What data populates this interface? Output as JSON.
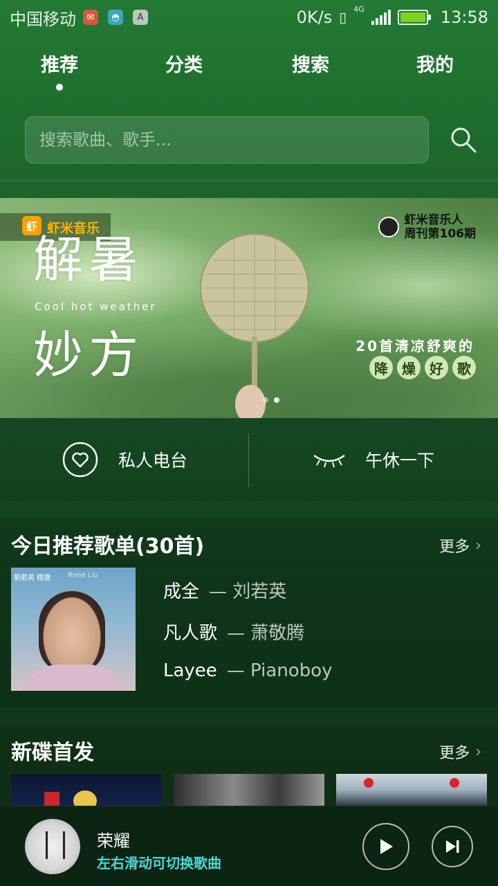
{
  "status_bar": {
    "carrier": "中国移动",
    "speed": "0K/s",
    "network": "4G",
    "time": "13:58",
    "app_icons": [
      "mail-icon",
      "android-icon",
      "a-icon"
    ]
  },
  "tabs": [
    {
      "label": "推荐",
      "active": true
    },
    {
      "label": "分类",
      "active": false
    },
    {
      "label": "搜索",
      "active": false
    },
    {
      "label": "我的",
      "active": false
    }
  ],
  "search": {
    "placeholder": "搜索歌曲、歌手..."
  },
  "banner": {
    "brand": "虾米音乐",
    "brand_logo": "虾",
    "title_line1": "解暑",
    "title_line2": "妙方",
    "subtitle": "Cool hot weather",
    "weekly_name": "虾米音乐人",
    "weekly_issue": "周刊第106期",
    "promo_line": "20首清凉舒爽的",
    "promo_chips": [
      "降",
      "燥",
      "好",
      "歌"
    ],
    "page_count": 2,
    "active_page": 2
  },
  "quick_actions": [
    {
      "label": "私人电台",
      "icon": "heart-icon"
    },
    {
      "label": "午休一下",
      "icon": "closed-eye-icon"
    }
  ],
  "recommend": {
    "title": "今日推荐歌单(30首)",
    "more": "更多",
    "cover_title": "劉若英 精選",
    "cover_tag": "René Liu",
    "songs": [
      {
        "title": "成全",
        "artist": "— 刘若英"
      },
      {
        "title": "凡人歌",
        "artist": "— 萧敬腾"
      },
      {
        "title": "Layee",
        "artist": "— Pianoboy"
      }
    ]
  },
  "new_discs": {
    "title": "新碟首发",
    "more": "更多"
  },
  "player": {
    "title": "荣耀",
    "hint": "左右滑动可切换歌曲"
  },
  "colors": {
    "accent_hint": "#4ad9d9",
    "brand_orange": "#ff9f00",
    "battery_green": "#7ed321"
  }
}
